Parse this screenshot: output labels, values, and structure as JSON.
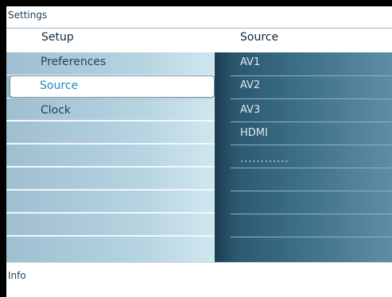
{
  "window": {
    "title": "Settings"
  },
  "columns": {
    "left_header": "Setup",
    "right_header": "Source"
  },
  "menu": {
    "items": [
      {
        "label": "Preferences",
        "selected": false
      },
      {
        "label": "Source",
        "selected": true
      },
      {
        "label": "Clock",
        "selected": false
      }
    ]
  },
  "source_list": {
    "items": [
      "AV1",
      "AV2",
      "AV3",
      "HDMI"
    ],
    "placeholder": "............"
  },
  "info_bar": {
    "label": "Info"
  },
  "colors": {
    "selected_text": "#1f88bf",
    "left_panel": "#b6d4e1",
    "right_panel": "#2c5870",
    "background": "#000000"
  }
}
